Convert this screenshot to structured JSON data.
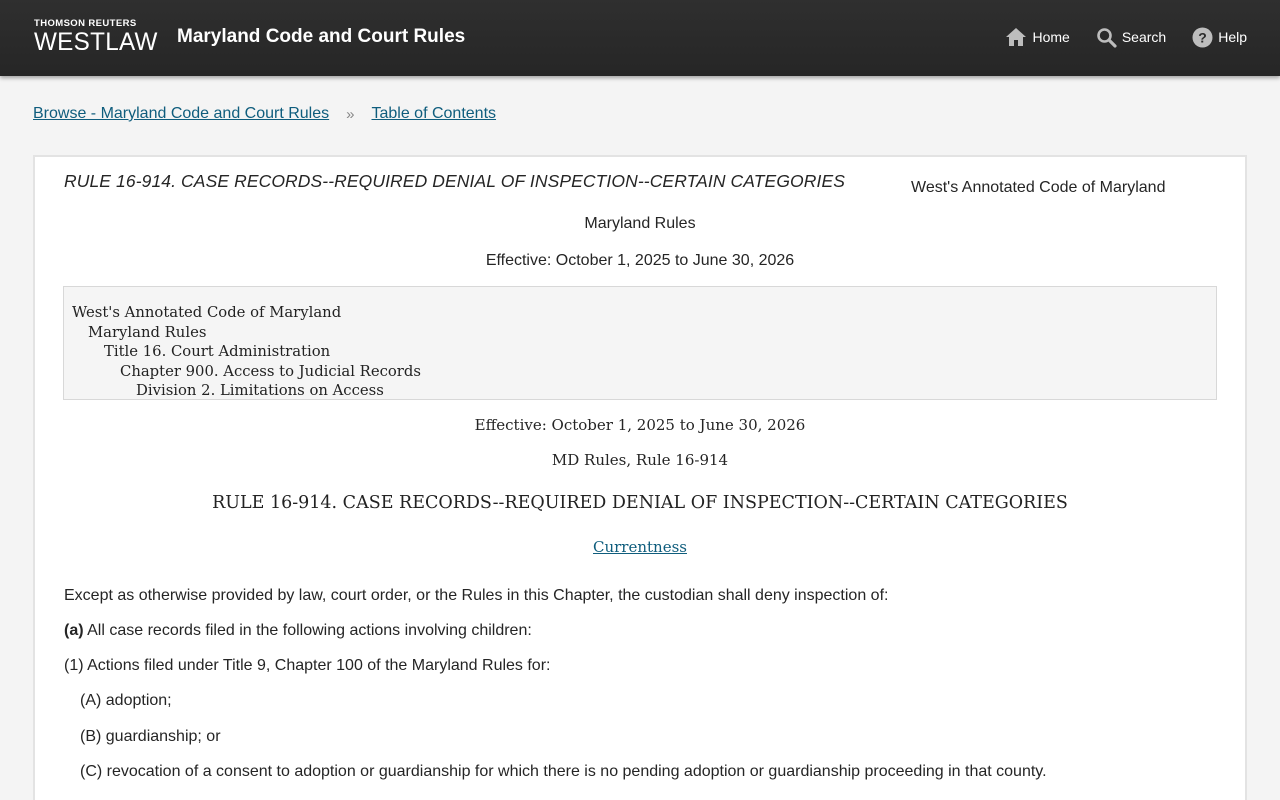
{
  "header": {
    "brand_small": "THOMSON REUTERS",
    "brand_big": "WESTLAW",
    "site_title": "Maryland Code and Court Rules",
    "nav": [
      {
        "label": "Home",
        "icon": "home-icon"
      },
      {
        "label": "Search",
        "icon": "search-icon"
      },
      {
        "label": "Help",
        "icon": "help-icon"
      }
    ]
  },
  "breadcrumb": {
    "items": [
      "Browse - Maryland Code and Court Rules",
      "Table of Contents"
    ],
    "separator": "»"
  },
  "document": {
    "head_title": "RULE 16-914. CASE RECORDS--REQUIRED DENIAL OF INSPECTION--CERTAIN CATEGORIES",
    "publication": "West's Annotated Code of Maryland",
    "subtitle": "Maryland Rules",
    "effective_top": "Effective: October 1, 2025 to June 30, 2026",
    "hierarchy": [
      "West's Annotated Code of Maryland",
      "Maryland Rules",
      "Title 16. Court Administration",
      "Chapter 900. Access to Judicial Records",
      "Division 2. Limitations on Access"
    ],
    "effective": "Effective: October 1, 2025 to June 30, 2026",
    "citation": "MD Rules, Rule 16-914",
    "rule_title": "RULE 16-914. CASE RECORDS--REQUIRED DENIAL OF INSPECTION--CERTAIN CATEGORIES",
    "currentness_link": "Currentness",
    "intro": "Except as otherwise provided by law, court order, or the Rules in this Chapter, the custodian shall deny inspection of:",
    "para_a_label": "(a)",
    "para_a_text": " All case records filed in the following actions involving children:",
    "para_1": "(1) Actions filed under Title 9, Chapter 100 of the Maryland Rules for:",
    "para_A": "(A) adoption;",
    "para_B": "(B) guardianship; or",
    "para_C": "(C) revocation of a consent to adoption or guardianship for which there is no pending adoption or guardianship proceeding in that county."
  },
  "colors": {
    "header_bg": "#2b2b2b",
    "link": "#0f5d7d",
    "page_bg": "#f4f4f4"
  }
}
